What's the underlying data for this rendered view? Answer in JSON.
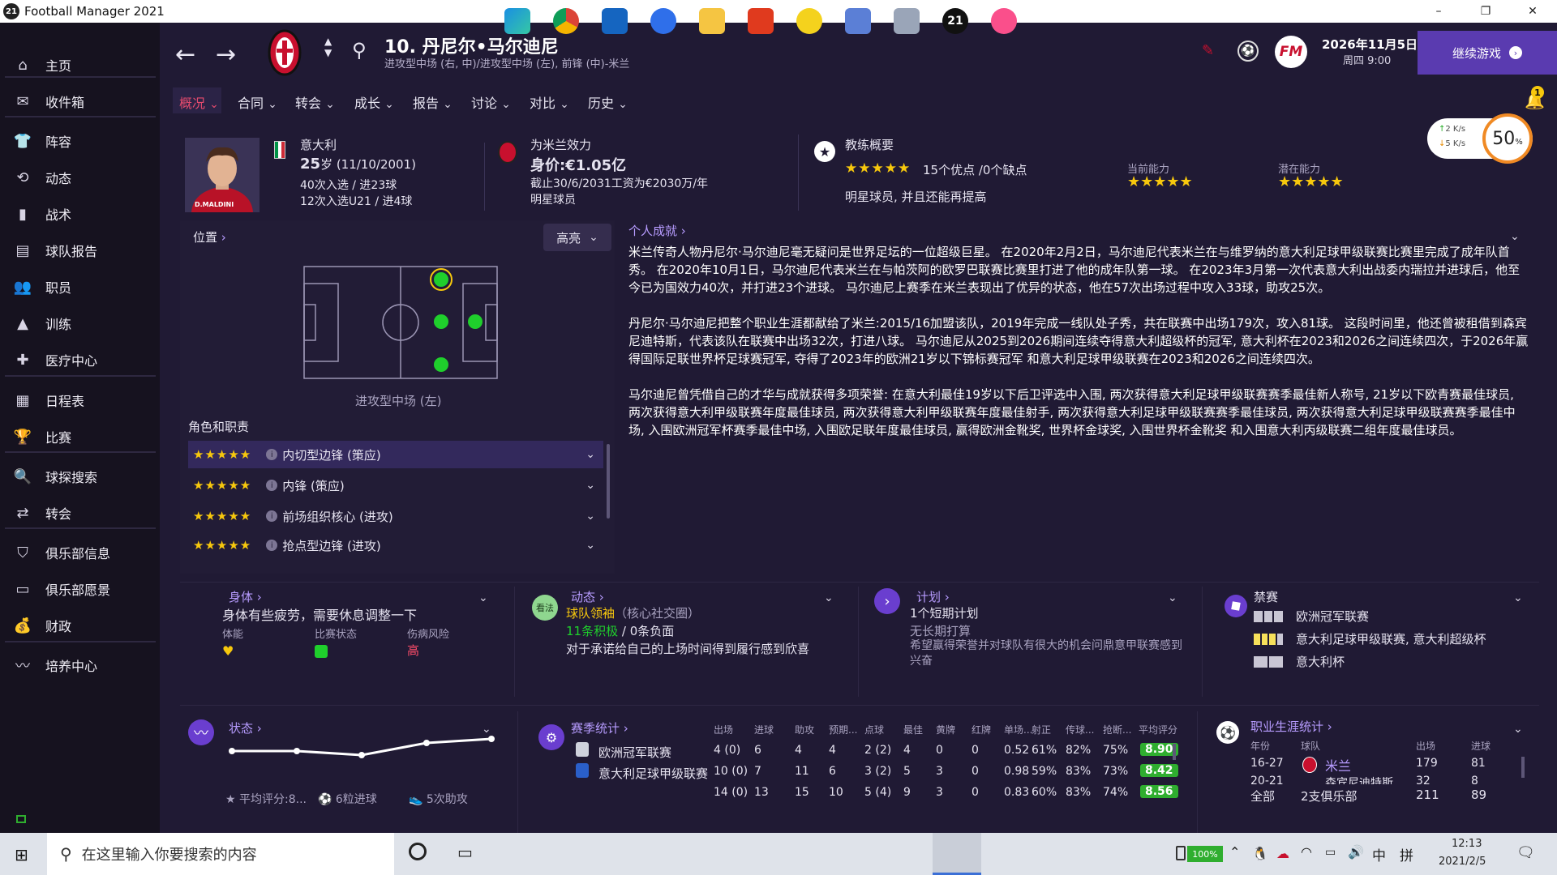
{
  "window": {
    "title": "Football Manager 2021",
    "logo": "21",
    "minimize": "–",
    "restore": "❐",
    "close": "✕"
  },
  "sidebar": {
    "items": [
      {
        "label": "主页",
        "icon": "home-icon",
        "glyph": "⌂"
      },
      {
        "label": "收件箱",
        "icon": "inbox-icon",
        "glyph": "✉"
      },
      {
        "label": "阵容",
        "icon": "shirt-icon",
        "glyph": "👕"
      },
      {
        "label": "动态",
        "icon": "dynamics-icon",
        "glyph": "⟲"
      },
      {
        "label": "战术",
        "icon": "tactics-icon",
        "glyph": "▮"
      },
      {
        "label": "球队报告",
        "icon": "report-icon",
        "glyph": "▤"
      },
      {
        "label": "职员",
        "icon": "staff-icon",
        "glyph": "👥"
      },
      {
        "label": "训练",
        "icon": "training-icon",
        "glyph": "▲"
      },
      {
        "label": "医疗中心",
        "icon": "medical-icon",
        "glyph": "✚"
      },
      {
        "label": "日程表",
        "icon": "calendar-icon",
        "glyph": "▦"
      },
      {
        "label": "比赛",
        "icon": "trophy-icon",
        "glyph": "🏆"
      },
      {
        "label": "球探搜索",
        "icon": "scout-search-icon",
        "glyph": "🔍"
      },
      {
        "label": "转会",
        "icon": "transfer-icon",
        "glyph": "⇄"
      },
      {
        "label": "俱乐部信息",
        "icon": "club-shield-icon",
        "glyph": "⛉"
      },
      {
        "label": "俱乐部愿景",
        "icon": "vision-icon",
        "glyph": "▭"
      },
      {
        "label": "财政",
        "icon": "finance-icon",
        "glyph": "💰"
      },
      {
        "label": "培养中心",
        "icon": "development-icon",
        "glyph": "〰"
      }
    ]
  },
  "header": {
    "number_name": "10. 丹尼尔•马尔迪尼",
    "positions": "进攻型中场 (右, 中)/进攻型中场 (左), 前锋 (中)-米兰",
    "date": "2026年11月5日",
    "weekday_time": "周四 9:00",
    "continue": "继续游戏",
    "fm_logo": "FM",
    "notif_count": "1"
  },
  "tabs": [
    "概况",
    "合同",
    "转会",
    "成长",
    "报告",
    "讨论",
    "对比",
    "历史"
  ],
  "network": {
    "up": "2 K/s",
    "down": "5 K/s",
    "percent": "50",
    "percent_unit": "%"
  },
  "profile": {
    "nation": "意大利",
    "age": "25",
    "age_label": "岁 (11/10/2001)",
    "caps": "40次入选 / 进23球",
    "u21": "12次入选U21 / 进4球",
    "shirt_name": "D.MALDINI",
    "club_label": "为米兰效力",
    "value": "身价:€1.05亿",
    "wage": "截止30/6/2031工资为€2030万/年",
    "status": "明星球员",
    "coach_title": "教练概要",
    "coach_stars": "★★★★★",
    "coach_summary": "15个优点 /0个缺点",
    "coach_note": "明星球员, 并且还能再提高",
    "current_ability": "当前能力",
    "potential_ability": "潜在能力",
    "ca_stars": "★★★★★",
    "pa_stars": "★★★★★"
  },
  "position_panel": {
    "title": "位置",
    "highlight": "高亮",
    "selected_position": "进攻型中场 (左)",
    "roles_title": "角色和职责",
    "roles": [
      {
        "stars": "★★★★★",
        "name": "内切型边锋 (策应)"
      },
      {
        "stars": "★★★★★",
        "name": "内锋 (策应)"
      },
      {
        "stars": "★★★★★",
        "name": "前场组织核心 (进攻)"
      },
      {
        "stars": "★★★★★",
        "name": "抢点型边锋 (进攻)"
      }
    ]
  },
  "bio": {
    "title": "个人成就",
    "p1": "米兰传奇人物丹尼尔·马尔迪尼毫无疑问是世界足坛的一位超级巨星。 在2020年2月2日，马尔迪尼代表米兰在与维罗纳的意大利足球甲级联赛比赛里完成了成年队首秀。 在2020年10月1日，马尔迪尼代表米兰在与帕茨阿的欧罗巴联赛比赛里打进了他的成年队第一球。 在2023年3月第一次代表意大利出战委内瑞拉并进球后，他至今已为国效力40次，并打进23个进球。 马尔迪尼上赛季在米兰表现出了优异的状态，他在57次出场过程中攻入33球，助攻25次。",
    "p2": "丹尼尔·马尔迪尼把整个职业生涯都献给了米兰:2015/16加盟该队，2019年完成一线队处子秀，共在联赛中出场179次，攻入81球。 这段时间里，他还曾被租借到森宾尼迪特斯，代表该队在联赛中出场32次，打进八球。 马尔迪尼从2025到2026期间连续夺得意大利超级杯的冠军, 意大利杯在2023和2026之间连续四次，于2026年赢得国际足联世界杯足球赛冠军, 夺得了2023年的欧洲21岁以下锦标赛冠军 和意大利足球甲级联赛在2023和2026之间连续四次。",
    "p3": "马尔迪尼曾凭借自己的才华与成就获得多项荣誉: 在意大利最佳19岁以下后卫评选中入围, 两次获得意大利足球甲级联赛赛季最佳新人称号, 21岁以下欧青赛最佳球员, 两次获得意大利甲级联赛年度最佳球员, 两次获得意大利甲级联赛年度最佳射手, 两次获得意大利足球甲级联赛赛季最佳球员, 两次获得意大利足球甲级联赛赛季最佳中场, 入围欧洲冠军杯赛季最佳中场, 入围欧足联年度最佳球员, 赢得欧洲金靴奖, 世界杯金球奖, 入围世界杯金靴奖 和入围意大利丙级联赛二组年度最佳球员。"
  },
  "physical": {
    "title": "身体",
    "desc": "身体有些疲劳，需要休息调整一下",
    "fitness": "体能",
    "match_status": "比赛状态",
    "injury_risk": "伤病风险",
    "injury_value": "高"
  },
  "dynamics": {
    "badge": "看法",
    "title": "动态",
    "leader": "球队领袖",
    "leader_sub": "（核心社交圈）",
    "positive": "11条积极",
    "slash": " / ",
    "negative": "0条负面",
    "note": "对于承诺给自己的上场时间得到履行感到欣喜"
  },
  "plans": {
    "title": "计划",
    "count": "1个短期计划",
    "long": "无长期打算",
    "note": "希望赢得荣誉并对球队有很大的机会问鼎意甲联赛感到兴奋"
  },
  "bans": {
    "title": "禁赛",
    "items": [
      "欧洲冠军联赛",
      "意大利足球甲级联赛, 意大利超级杯",
      "意大利杯"
    ]
  },
  "form": {
    "title": "状态",
    "avg": "平均评分:8...",
    "goals": "6粒进球",
    "assists": "5次助攻",
    "points": [
      7.6,
      7.6,
      7.4,
      8.0,
      8.2
    ]
  },
  "season": {
    "title": "赛季统计",
    "headers": [
      "出场",
      "进球",
      "助攻",
      "预期...",
      "点球",
      "最佳",
      "黄牌",
      "红牌",
      "单场...",
      "射正",
      "传球...",
      "抢断...",
      "平均评分"
    ],
    "rows": [
      {
        "comp": "欧洲冠军联赛",
        "vals": [
          "4 (0)",
          "6",
          "4",
          "4",
          "2 (2)",
          "4",
          "0",
          "0",
          "0.52",
          "61%",
          "82%",
          "75%"
        ],
        "rating": "8.90"
      },
      {
        "comp": "意大利足球甲级联赛",
        "vals": [
          "10 (0)",
          "7",
          "11",
          "6",
          "3 (2)",
          "5",
          "3",
          "0",
          "0.98",
          "59%",
          "83%",
          "73%"
        ],
        "rating": "8.42"
      },
      {
        "comp": "",
        "vals": [
          "14 (0)",
          "13",
          "15",
          "10",
          "5 (4)",
          "9",
          "3",
          "0",
          "0.83",
          "60%",
          "83%",
          "74%"
        ],
        "rating": "8.56"
      }
    ]
  },
  "career": {
    "title": "职业生涯统计",
    "headers": [
      "年份",
      "球队",
      "出场",
      "进球"
    ],
    "rows": [
      {
        "year": "16-27",
        "club": "米兰",
        "apps": "179",
        "goals": "81"
      },
      {
        "year": "20-21",
        "club": "森宾尼迪特斯",
        "apps": "32",
        "goals": "8"
      }
    ],
    "total": {
      "label": "全部",
      "clubs": "2支俱乐部",
      "apps": "211",
      "goals": "89"
    }
  },
  "taskbar": {
    "search": "在这里输入你要搜索的内容",
    "battery": "100%",
    "ime": "中",
    "ime2": "拼",
    "time": "12:13",
    "date": "2021/2/5"
  }
}
